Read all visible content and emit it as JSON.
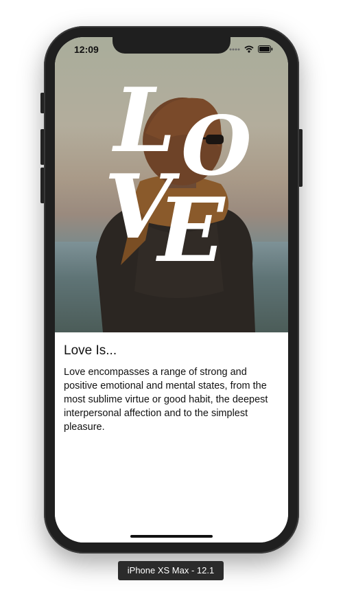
{
  "status_bar": {
    "time": "12:09"
  },
  "hero": {
    "letters": [
      "L",
      "O",
      "V",
      "E"
    ]
  },
  "article": {
    "title": "Love Is...",
    "body": "Love encompasses a range of strong and positive emotional and mental states, from the most sublime virtue or good habit, the deepest interpersonal affection and to the simplest pleasure."
  },
  "device": {
    "label": "iPhone XS Max - 12.1"
  },
  "colors": {
    "frame": "#1f1f1f",
    "text": "#111111",
    "label_bg": "#2b2b2b"
  },
  "icons": [
    "signal-dots-icon",
    "wifi-icon",
    "battery-icon"
  ]
}
